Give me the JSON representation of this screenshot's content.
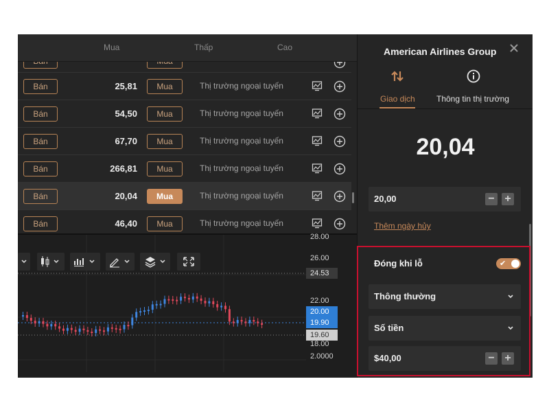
{
  "table": {
    "headers": {
      "buy": "Mua",
      "low": "Thấp",
      "high": "Cao"
    },
    "partial_row": {
      "sell": "Bán",
      "buy": "Mua"
    },
    "rows": [
      {
        "sell": "Bán",
        "price": "25,81",
        "buy": "Mua",
        "status": "Thị trường ngoại tuyến"
      },
      {
        "sell": "Bán",
        "price": "54,50",
        "buy": "Mua",
        "status": "Thị trường ngoại tuyến"
      },
      {
        "sell": "Bán",
        "price": "67,70",
        "buy": "Mua",
        "status": "Thị trường ngoại tuyến"
      },
      {
        "sell": "Bán",
        "price": "266,81",
        "buy": "Mua",
        "status": "Thị trường ngoại tuyến"
      },
      {
        "sell": "Bán",
        "price": "20,04",
        "buy": "Mua",
        "status": "Thị trường ngoại tuyến",
        "selected": true
      },
      {
        "sell": "Bán",
        "price": "46,40",
        "buy": "Mua",
        "status": "Thị trường ngoại tuyến"
      }
    ]
  },
  "chart": {
    "y_labels": [
      "28.00",
      "26.00",
      "22.00",
      "18.00",
      "2.0000"
    ],
    "marker_levels": {
      "high": "24.53",
      "ask": "20.00",
      "bid": "19.90",
      "low": "19.60"
    },
    "marker_colors": {
      "high": "#3a3a3a",
      "ask": "#2f7fd6",
      "bid": "#2f7fd6",
      "low": "#d0d0d0"
    },
    "toolbar_icons": [
      "chevron-down-icon",
      "candlestick-icon",
      "bar-chart-icon",
      "draw-tool-icon",
      "layers-icon",
      "fullscreen-icon"
    ],
    "candle_colors": {
      "up": "#3f86e0",
      "down": "#e0485a"
    }
  },
  "panel": {
    "title": "American Airlines Group",
    "tabs": [
      {
        "label": "Giao dịch",
        "icon": "trade-arrows-icon",
        "active": true
      },
      {
        "label": "Thông tin thị trường",
        "icon": "info-icon",
        "active": false
      }
    ],
    "price": "20,04",
    "amount": "20,00",
    "add_expiry": "Thêm ngày hủy",
    "stop_loss": {
      "label": "Đóng khi lỗ",
      "enabled": true
    },
    "order_type": "Thông thường",
    "unit": "Số tiền",
    "stop_amount": "$40,00",
    "accent": "#c7895a"
  }
}
